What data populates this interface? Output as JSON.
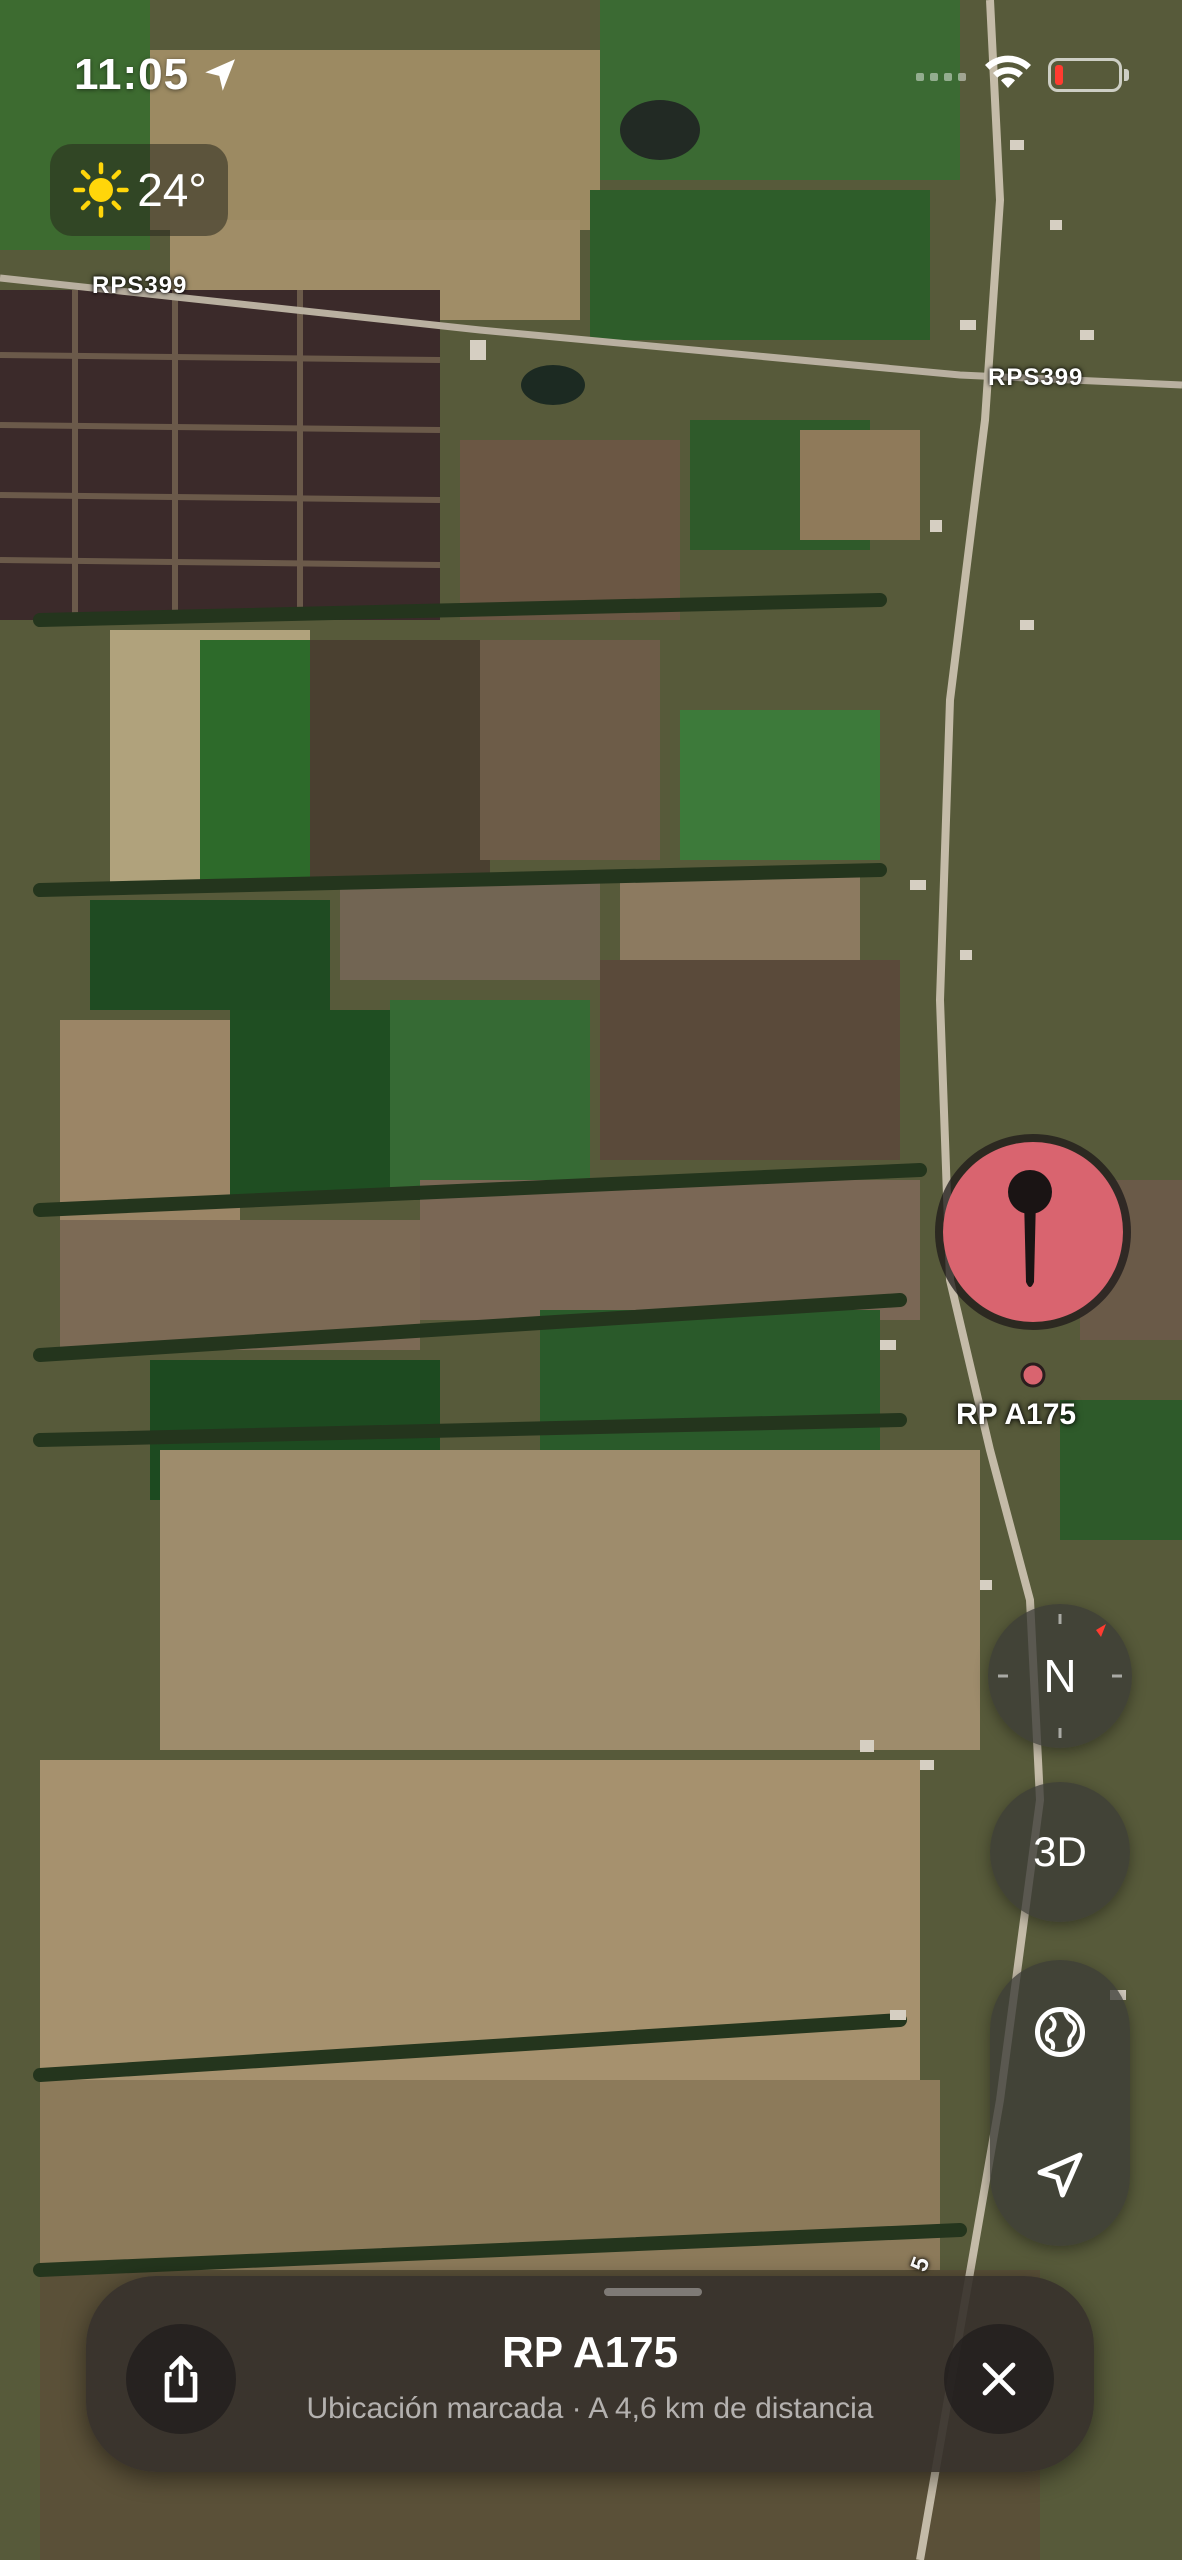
{
  "status_bar": {
    "time": "11:05"
  },
  "weather": {
    "temperature": "24°"
  },
  "map": {
    "road_labels": [
      "RPS399",
      "RPS399",
      "5"
    ],
    "pin_label": "RP A175"
  },
  "controls": {
    "compass_label": "N",
    "mode_3d_label": "3D"
  },
  "place_sheet": {
    "title": "RP A175",
    "subtitle": "Ubicación marcada · A 4,6 km de distancia"
  },
  "icons": {
    "status": [
      "location-arrow-icon",
      "wifi-icon",
      "battery-icon"
    ],
    "weather": "sun-icon",
    "controls": [
      "globe-icon",
      "navigation-arrow-icon"
    ],
    "sheet": [
      "share-icon",
      "close-icon"
    ]
  },
  "colors": {
    "pin": "#d9646f",
    "battery_low": "#ff3b30",
    "compass_needle": "#ff3b30"
  }
}
